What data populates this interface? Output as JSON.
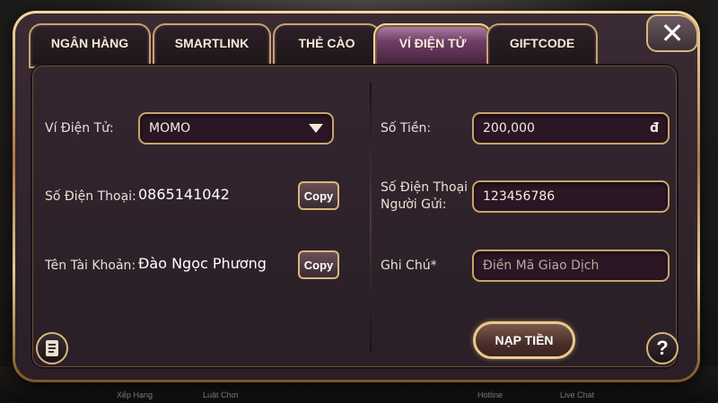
{
  "background": {
    "bottom_labels": [
      "Xếp Hạng",
      "Luật Chơi",
      "Hotline",
      "Live Chat"
    ]
  },
  "tabs": [
    {
      "label": "NGÂN HÀNG",
      "active": false
    },
    {
      "label": "SMARTLINK",
      "active": false
    },
    {
      "label": "THẺ CÀO",
      "active": false
    },
    {
      "label": "VÍ ĐIỆN TỬ",
      "active": true
    },
    {
      "label": "GIFTCODE",
      "active": false
    }
  ],
  "close_icon": "close-icon",
  "left": {
    "wallet_label": "Ví Điện Tử:",
    "wallet_value": "MOMO",
    "phone_label": "Số Điện Thoại:",
    "phone_value": "0865141042",
    "account_label": "Tên Tài Khoản:",
    "account_value": "Đào Ngọc Phương",
    "copy_label": "Copy"
  },
  "right": {
    "amount_label": "Số Tiền:",
    "amount_value": "200,000",
    "amount_currency": "đ",
    "sender_phone_label_line1": "Số Điện Thoại",
    "sender_phone_label_line2": "Người Gửi:",
    "sender_phone_value": "123456786",
    "note_label": "Ghi Chú*",
    "note_placeholder": "Điền Mã Giao Dịch",
    "submit_label": "NẠP TIỀN"
  },
  "colors": {
    "gold_border": "#c9a36a",
    "panel_bg": "#2a1f26",
    "active_tab": "#6f3e66"
  }
}
